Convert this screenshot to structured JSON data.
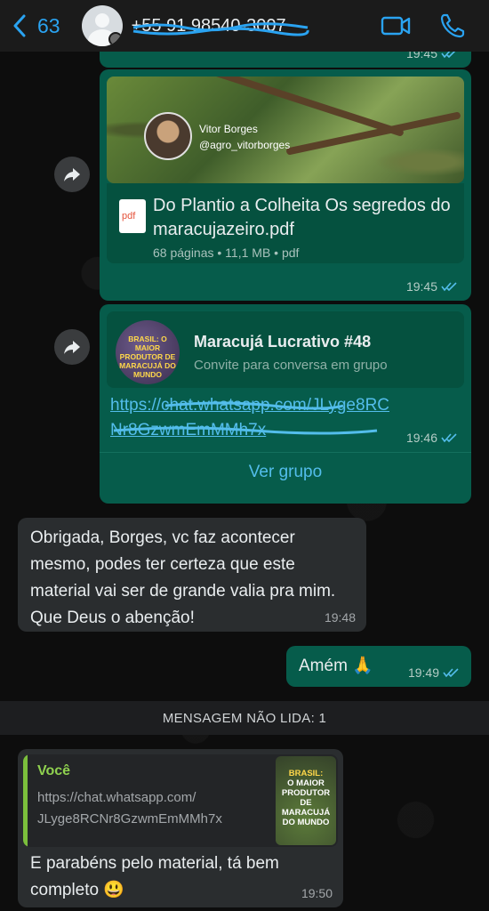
{
  "header": {
    "back_count": "63",
    "contact_name": "+55 91 98540-3007",
    "icons": [
      "back-chevron-icon",
      "video-call-icon",
      "phone-icon"
    ]
  },
  "messages": {
    "top_partial": {
      "time": "19:45"
    },
    "document": {
      "author_name": "Vitor Borges",
      "author_handle": "@agro_vitorborges",
      "pdf_badge": "pdf",
      "title": "Do Plantio a Colheita Os segredos do maracujazeiro.pdf",
      "meta": "68 páginas • 11,1 MB • pdf",
      "time": "19:45"
    },
    "group_invite": {
      "pic_text": "BRASIL: O MAIOR PRODUTOR DE MARACUJÁ DO MUNDO",
      "group_name": "Maracujá Lucrativo #48",
      "subtitle": "Convite para conversa em grupo",
      "link": "https://chat.whatsapp.com/JLyge8RCNr8GzwmEmMMh7x",
      "time": "19:46",
      "action_label": "Ver grupo"
    },
    "incoming_1": {
      "text": "Obrigada, Borges, vc faz acontecer mesmo, podes ter certeza que este material vai ser de grande valia pra mim. Que Deus o abenção!",
      "time": "19:48"
    },
    "outgoing_amen": {
      "text": "Amém 🙏",
      "time": "19:49"
    },
    "unread_label": "MENSAGEM NÃO LIDA: 1",
    "incoming_2": {
      "quote_author": "Você",
      "quote_line1": "https://chat.whatsapp.com/",
      "quote_line2": "JLyge8RCNr8GzwmEmMMh7x",
      "quote_thumb_yellow": "BRASIL:",
      "quote_thumb_white": "O MAIOR PRODUTOR DE MARACUJÁ DO MUNDO",
      "text": "E parabéns pelo material, tá bem completo 😃",
      "time": "19:50"
    }
  },
  "colors": {
    "accent": "#2aa3f1",
    "outgoing_bubble": "#065c4b",
    "incoming_bubble": "#2a2d2f",
    "link": "#53bdeb",
    "read_ticks": "#53bdeb"
  }
}
